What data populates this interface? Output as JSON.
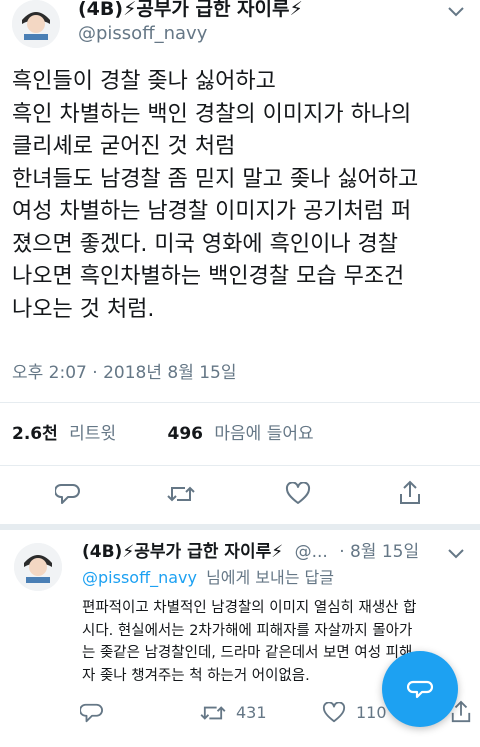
{
  "main_tweet": {
    "display_name": "(4B)⚡공부가 급한 자이루⚡",
    "handle": "@pissoff_navy",
    "lines": [
      "흑인들이 경찰 좆나 싫어하고",
      "흑인 차별하는 백인 경찰의 이미지가 하나의",
      "클리셰로 굳어진 것 처럼",
      "한녀들도 남경찰 좀 믿지 말고 좆나 싫어하고",
      "여성 차별하는 남경찰 이미지가 공기처럼 퍼",
      "졌으면 좋겠다. 미국 영화에 흑인이나 경찰",
      "나오면 흑인차별하는 백인경찰 모습 무조건",
      "나오는 것 처럼."
    ],
    "timestamp": "오후 2:07 · 2018년 8월 15일",
    "retweets_count": "2.6천",
    "retweets_label": "리트윗",
    "likes_count": "496",
    "likes_label": "마음에 들어요"
  },
  "reply": {
    "display_name": "(4B)⚡공부가 급한 자이루⚡",
    "handle_short": "@...",
    "date": "· 8월 15일",
    "reply_to_handle": "@pissoff_navy",
    "reply_to_suffix": "님에게 보내는 답글",
    "lines": [
      "편파적이고 차별적인 남경찰의 이미지 열심히 재생산 합",
      "시다. 현실에서는 2차가해에 피해자를 자살까지 몰아가",
      "는 좆같은 남경찰인데, 드라마 같은데서 보면 여성 피해",
      "자 좆나 챙겨주는 척 하는거 어이없음."
    ],
    "retweet_count": "431",
    "like_count": "110"
  },
  "icons": {
    "reply": "reply-icon",
    "retweet": "retweet-icon",
    "like": "heart-icon",
    "share": "share-icon",
    "compose": "compose-icon",
    "chevron": "chevron-down-icon"
  },
  "colors": {
    "accent": "#1da1f2",
    "text": "#14171a",
    "secondary": "#657786",
    "lightning": "#f5a623",
    "divider": "#e6ecf0"
  }
}
